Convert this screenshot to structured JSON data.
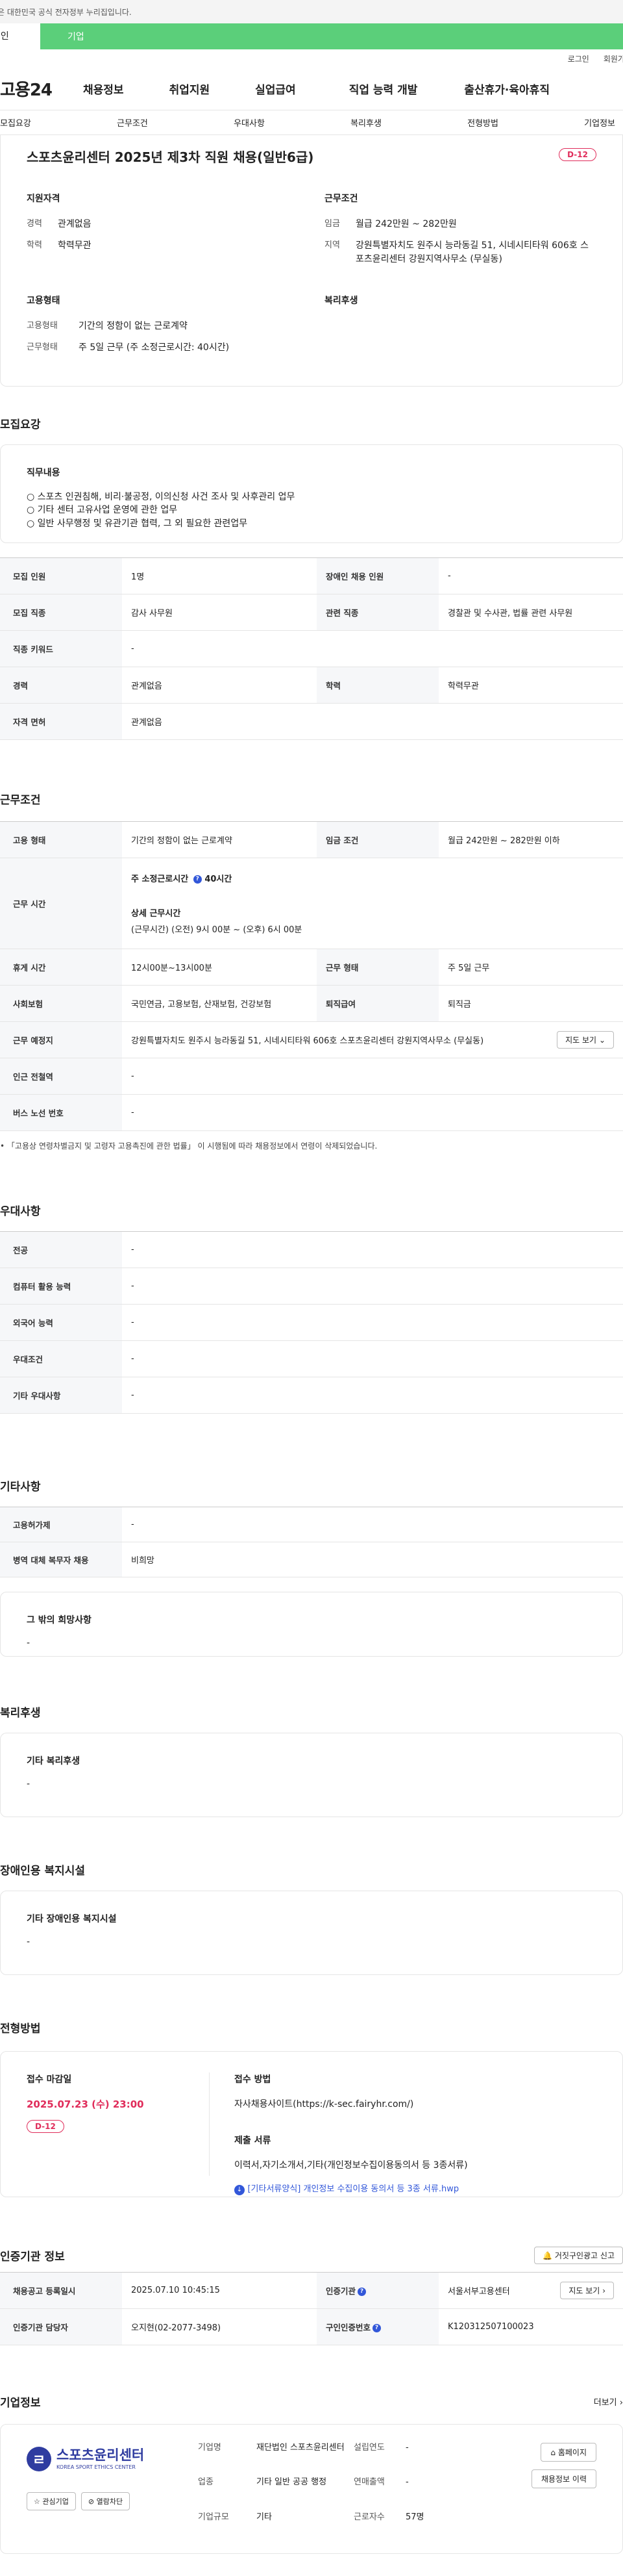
{
  "topbar": {
    "notice": "이 누리집은 대한민국 공식 전자정부 누리집입니다."
  },
  "tabs": {
    "personal": "개인",
    "corporate": "기업"
  },
  "util": {
    "login": "로그인",
    "join": "회원가입"
  },
  "gnb": {
    "logo": "고용24",
    "items": [
      "채용정보",
      "취업지원",
      "실업급여",
      "직업 능력 개발",
      "출산휴가·육아휴직"
    ]
  },
  "anchor_nav": [
    "모집요강",
    "근무조건",
    "우대사항",
    "복리후생",
    "전형방법",
    "기업정보"
  ],
  "summary": {
    "title": "스포츠윤리센터 2025년 제3차 직원 채용(일반6급)",
    "dday": "D-12",
    "qual": {
      "heading": "지원자격",
      "career_k": "경력",
      "career_v": "관계없음",
      "edu_k": "학력",
      "edu_v": "학력무관"
    },
    "cond": {
      "heading": "근무조건",
      "wage_k": "임금",
      "wage_v": "월급 242만원 ~ 282만원",
      "loc_k": "지역",
      "loc_v": "강원특별자치도 원주시 능라동길 51, 시네시티타워 606호 스포츠윤리센터 강원지역사무소 (무실동)"
    },
    "emp": {
      "heading": "고용형태",
      "type_k": "고용형태",
      "type_v": "기간의 정함이 없는 근로계약",
      "form_k": "근무형태",
      "form_v": "주 5일 근무 (주 소정근로시간: 40시간)"
    },
    "welfare": {
      "heading": "복리후생"
    }
  },
  "recruit": {
    "title": "모집요강",
    "job_heading": "직무내용",
    "job_items": [
      "○ 스포츠 인권침해, 비리·불공정, 이의신청 사건 조사 및 사후관리 업무",
      "○ 기타 센터 고유사업 운영에 관한 업무",
      "○ 일반 사무행정 및 유관기관 협력, 그 외 필요한 관련업무"
    ],
    "rows": {
      "headcount_k": "모집 인원",
      "headcount_v": "1명",
      "disabled_k": "장애인 채용 인원",
      "disabled_v": "-",
      "job_k": "모집 직종",
      "job_v": "감사 사무원",
      "rel_k": "관련 직종",
      "rel_v": "경찰관 및 수사관, 법률 관련 사무원",
      "kw_k": "직종 키워드",
      "kw_v": "-",
      "career_k": "경력",
      "career_v": "관계없음",
      "edu_k": "학력",
      "edu_v": "학력무관",
      "license_k": "자격 면허",
      "license_v": "관계없음"
    }
  },
  "work": {
    "title": "근무조건",
    "type_k": "고용 형태",
    "type_v": "기간의 정함이 없는 근로계약",
    "wage_k": "임금 조건",
    "wage_v": "월급 242만원 ~ 282만원 이하",
    "hours_k": "근무 시간",
    "hours_reg_label": "주 소정근로시간",
    "hours_reg_value": "40시간",
    "hours_detail_label": "상세 근무시간",
    "hours_detail_value": "(근무시간) (오전) 9시 00분 ~ (오후) 6시 00분",
    "break_k": "휴게 시간",
    "break_v": "12시00분~13시00분",
    "form_k": "근무 형태",
    "form_v": "주 5일 근무",
    "ins_k": "사회보험",
    "ins_v": "국민연금, 고용보험, 산재보험, 건강보험",
    "ret_k": "퇴직급여",
    "ret_v": "퇴직금",
    "place_k": "근무 예정지",
    "place_v": "강원특별자치도 원주시 능라동길 51, 시네시티타워 606호 스포츠윤리센터 강원지역사무소 (무실동)",
    "map_btn": "지도 보기",
    "subway_k": "인근 전철역",
    "subway_v": "-",
    "bus_k": "버스 노선 번호",
    "bus_v": "-",
    "note": "「고용상 연령차별금지 및 고령자 고용촉진에 관한 법률」 이 시행됨에 따라 채용정보에서 연령이 삭제되었습니다."
  },
  "pref": {
    "title": "우대사항",
    "major_k": "전공",
    "major_v": "-",
    "pc_k": "컴퓨터 활용 능력",
    "pc_v": "-",
    "lang_k": "외국어 능력",
    "lang_v": "-",
    "cond_k": "우대조건",
    "cond_v": "-",
    "etc_k": "기타 우대사항",
    "etc_v": "-"
  },
  "misc": {
    "title": "기타사항",
    "permit_k": "고용허가제",
    "permit_v": "-",
    "mil_k": "병역 대체 복무자 채용",
    "mil_v": "비희망",
    "wish_heading": "그 밖의 희망사항",
    "wish_v": "-"
  },
  "welfare": {
    "title": "복리후생",
    "heading": "기타 복리후생",
    "value": "-"
  },
  "disab": {
    "title": "장애인용 복지시설",
    "heading": "기타 장애인용 복지시설",
    "value": "-"
  },
  "process": {
    "title": "전형방법",
    "deadline_heading": "접수 마감일",
    "deadline": "2025.07.23 (수) 23:00",
    "dday": "D-12",
    "method_heading": "접수 방법",
    "method_v": "자사채용사이트(https://k-sec.fairyhr.com/)",
    "docs_heading": "제출 서류",
    "docs_v": "이력서,자기소개서,기타(개인정보수집이용동의서 등 3종서류)",
    "file": "[기타서류양식] 개인정보 수집이용 동의서 등 3종 서류.hwp"
  },
  "cert": {
    "title": "인증기관 정보",
    "report_btn": "거짓구인광고 신고",
    "reg_k": "채용공고 등록일시",
    "reg_v": "2025.07.10 10:45:15",
    "org_k": "인증기관",
    "org_v": "서울서부고용센터",
    "map_btn": "지도 보기",
    "manager_k": "인증기관 담당자",
    "manager_v": "오지현(02-2077-3498)",
    "num_k": "구인인증번호",
    "num_v": "K120312507100023"
  },
  "company": {
    "title": "기업정보",
    "more": "더보기",
    "logo_name": "스포츠윤리센터",
    "logo_en": "KOREA SPORT ETHICS CENTER",
    "logo_mark": "ㄹ",
    "fav_btn": "관심기업",
    "block_btn": "열람차단",
    "name_k": "기업명",
    "name_v": "재단법인 스포츠윤리센터",
    "ind_k": "업종",
    "ind_v": "기타 일반 공공 행정",
    "size_k": "기업규모",
    "size_v": "기타",
    "est_k": "설립연도",
    "est_v": "-",
    "sales_k": "연매출액",
    "sales_v": "-",
    "emp_k": "근로자수",
    "emp_v": "57명",
    "home_btn": "홈페이지",
    "recruit_btn": "채용정보 이력"
  }
}
